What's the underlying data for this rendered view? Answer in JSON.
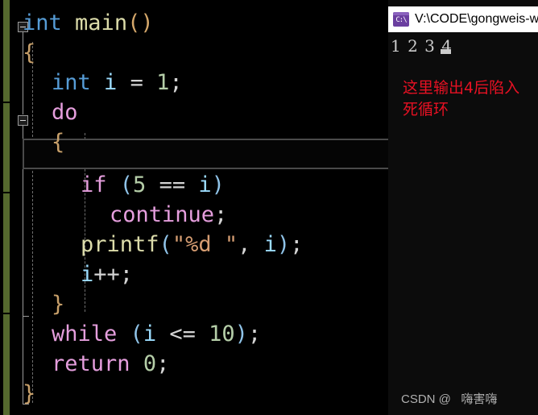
{
  "editor": {
    "language": "c",
    "background": "#000000",
    "change_bar_color": "#55692e",
    "current_line_index": 4,
    "lines": [
      {
        "indent": 0,
        "text": "int main()"
      },
      {
        "indent": 0,
        "text": "{"
      },
      {
        "indent": 1,
        "text": "int i = 1;"
      },
      {
        "indent": 1,
        "text": "do"
      },
      {
        "indent": 1,
        "text": "{"
      },
      {
        "indent": 2,
        "text": "if (5 == i)"
      },
      {
        "indent": 3,
        "text": "continue;"
      },
      {
        "indent": 2,
        "text": "printf(\"%d \", i);"
      },
      {
        "indent": 2,
        "text": "i++;"
      },
      {
        "indent": 1,
        "text": "}"
      },
      {
        "indent": 1,
        "text": "while (i <= 10);"
      },
      {
        "indent": 1,
        "text": "return 0;"
      },
      {
        "indent": 0,
        "text": "}"
      }
    ],
    "tokens": {
      "line0": [
        {
          "t": "int",
          "c": "t-kw"
        },
        {
          "t": " ",
          "c": "t-op"
        },
        {
          "t": "main",
          "c": "t-fn"
        },
        {
          "t": "()",
          "c": "t-paren"
        }
      ],
      "line1": [
        {
          "t": "{",
          "c": "t-brace"
        }
      ],
      "line2": [
        {
          "t": "int",
          "c": "t-kw"
        },
        {
          "t": " ",
          "c": "t-op"
        },
        {
          "t": "i",
          "c": "t-var"
        },
        {
          "t": " ",
          "c": "t-op"
        },
        {
          "t": "=",
          "c": "t-op"
        },
        {
          "t": " ",
          "c": "t-op"
        },
        {
          "t": "1",
          "c": "t-num"
        },
        {
          "t": ";",
          "c": "t-punc"
        }
      ],
      "line3": [
        {
          "t": "do",
          "c": "t-ctrl"
        }
      ],
      "line4": [
        {
          "t": "{",
          "c": "t-brace"
        }
      ],
      "line5": [
        {
          "t": "if",
          "c": "t-ctrl"
        },
        {
          "t": " ",
          "c": "t-op"
        },
        {
          "t": "(",
          "c": "t-paren2"
        },
        {
          "t": "5",
          "c": "t-num"
        },
        {
          "t": " == ",
          "c": "t-op"
        },
        {
          "t": "i",
          "c": "t-var"
        },
        {
          "t": ")",
          "c": "t-paren2"
        }
      ],
      "line6": [
        {
          "t": "continue",
          "c": "t-ctrl"
        },
        {
          "t": ";",
          "c": "t-punc"
        }
      ],
      "line7": [
        {
          "t": "printf",
          "c": "t-fn"
        },
        {
          "t": "(",
          "c": "t-paren2"
        },
        {
          "t": "\"%d \"",
          "c": "t-str"
        },
        {
          "t": ",",
          "c": "t-punc"
        },
        {
          "t": " ",
          "c": "t-op"
        },
        {
          "t": "i",
          "c": "t-var"
        },
        {
          "t": ")",
          "c": "t-paren2"
        },
        {
          "t": ";",
          "c": "t-punc"
        }
      ],
      "line8": [
        {
          "t": "i",
          "c": "t-var"
        },
        {
          "t": "++",
          "c": "t-op"
        },
        {
          "t": ";",
          "c": "t-punc"
        }
      ],
      "line9": [
        {
          "t": "}",
          "c": "t-brace"
        }
      ],
      "line10": [
        {
          "t": "while",
          "c": "t-ctrl"
        },
        {
          "t": " ",
          "c": "t-op"
        },
        {
          "t": "(",
          "c": "t-paren2"
        },
        {
          "t": "i",
          "c": "t-var"
        },
        {
          "t": " <= ",
          "c": "t-op"
        },
        {
          "t": "10",
          "c": "t-num"
        },
        {
          "t": ")",
          "c": "t-paren2"
        },
        {
          "t": ";",
          "c": "t-punc"
        }
      ],
      "line11": [
        {
          "t": "return",
          "c": "t-ctrl"
        },
        {
          "t": " ",
          "c": "t-op"
        },
        {
          "t": "0",
          "c": "t-num"
        },
        {
          "t": ";",
          "c": "t-punc"
        }
      ],
      "line12": [
        {
          "t": "}",
          "c": "t-brace"
        }
      ]
    },
    "fold_markers": [
      {
        "line": 0,
        "state": "expanded"
      },
      {
        "line": 3,
        "state": "expanded"
      }
    ]
  },
  "console": {
    "icon": "command-prompt-icon",
    "icon_glyph": "C:\\",
    "title": "V:\\CODE\\gongweis-w",
    "output": "1 2 3 4 ",
    "cursor": "block",
    "note": "这里输出4后陷入死循环",
    "note_color": "#e81123",
    "watermark": "CSDN @   嗨害嗨"
  }
}
